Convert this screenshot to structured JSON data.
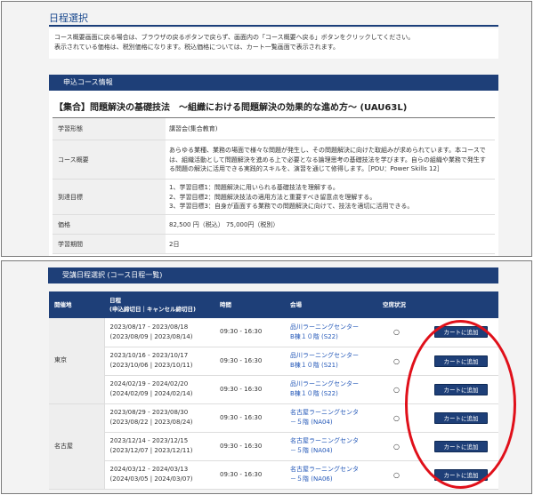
{
  "header": {
    "title": "日程選択",
    "notice_lines": [
      "コース概要画面に戻る場合は、ブラウザの戻るボタンで戻らず、画面内の「コース概要へ戻る」ボタンをクリックしてください。",
      "表示されている価格は、税別価格になります。税込価格については、カート一覧画面で表示されます。"
    ]
  },
  "course_info": {
    "section_label": "申込コース情報",
    "title": "【集合】問題解決の基礎技法　～組織における問題解決の効果的な進め方～ (UAU63L)",
    "rows": [
      {
        "label": "学習形態",
        "lines": [
          "講習会(集合教育)"
        ]
      },
      {
        "label": "コース概要",
        "lines": [
          "あらゆる業種、業務の場面で様々な問題が発生し、その問題解決に向けた取組みが求められています。本コースで",
          "は、組織活動として問題解決を進める上で必要となる論理思考の基礎技法を学びます。自らの組織や業務で発生す",
          "る問題の解決に活用できる実践的スキルを、演習を通じて修得します。［PDU：Power Skills 12］"
        ]
      },
      {
        "label": "到達目標",
        "lines": [
          "1、学習目標1：問題解決に用いられる基礎技法を理解する。",
          "2、学習目標2：問題解決技法の適用方法と重要すべき留意点を理解する。",
          "3、学習目標3：自身が直面する業務での問題解決に向けて、技法を適切に活用できる。"
        ]
      },
      {
        "label": "価格",
        "lines": [
          "82,500 円（税込） 75,000円（税別）"
        ]
      },
      {
        "label": "学習期間",
        "lines": [
          "2日"
        ]
      }
    ]
  },
  "schedule": {
    "section_label": "受講日程選択 (コース日程一覧)",
    "headers": {
      "location": "開催地",
      "date_line1": "日程",
      "date_line2": "(申込締切日｜キャンセル締切日)",
      "time": "時間",
      "venue": "会場",
      "status": "空席状況"
    },
    "cart_label": "カートに追加",
    "groups": [
      {
        "location": "東京",
        "rows": [
          {
            "date": "2023/08/17 - 2023/08/18",
            "deadline": "(2023/08/09 | 2023/08/14)",
            "time": "09:30 - 16:30",
            "venue1": "品川ラーニングセンター",
            "venue2": "B棟１０階 (S22)",
            "status": "○"
          },
          {
            "date": "2023/10/16 - 2023/10/17",
            "deadline": "(2023/10/06 | 2023/10/11)",
            "time": "09:30 - 16:30",
            "venue1": "品川ラーニングセンター",
            "venue2": "B棟１０階 (S21)",
            "status": "○"
          },
          {
            "date": "2024/02/19 - 2024/02/20",
            "deadline": "(2024/02/09 | 2024/02/14)",
            "time": "09:30 - 16:30",
            "venue1": "品川ラーニングセンター",
            "venue2": "B棟１０階 (S22)",
            "status": "○"
          }
        ]
      },
      {
        "location": "名古屋",
        "rows": [
          {
            "date": "2023/08/29 - 2023/08/30",
            "deadline": "(2023/08/22 | 2023/08/24)",
            "time": "09:30 - 16:30",
            "venue1": "名古屋ラーニングセンタ",
            "venue2": "－５階 (NA04)",
            "status": "○"
          },
          {
            "date": "2023/12/14 - 2023/12/15",
            "deadline": "(2023/12/07 | 2023/12/11)",
            "time": "09:30 - 16:30",
            "venue1": "名古屋ラーニングセンタ",
            "venue2": "－５階 (NA04)",
            "status": "○"
          },
          {
            "date": "2024/03/12 - 2024/03/13",
            "deadline": "(2024/03/05 | 2024/03/07)",
            "time": "09:30 - 16:30",
            "venue1": "名古屋ラーニングセンタ",
            "venue2": "－５階 (NA06)",
            "status": "○"
          }
        ]
      }
    ]
  },
  "colors": {
    "header_bar": "#1e3f78",
    "link": "#2458b8",
    "highlight_oval": "#e0101a"
  }
}
